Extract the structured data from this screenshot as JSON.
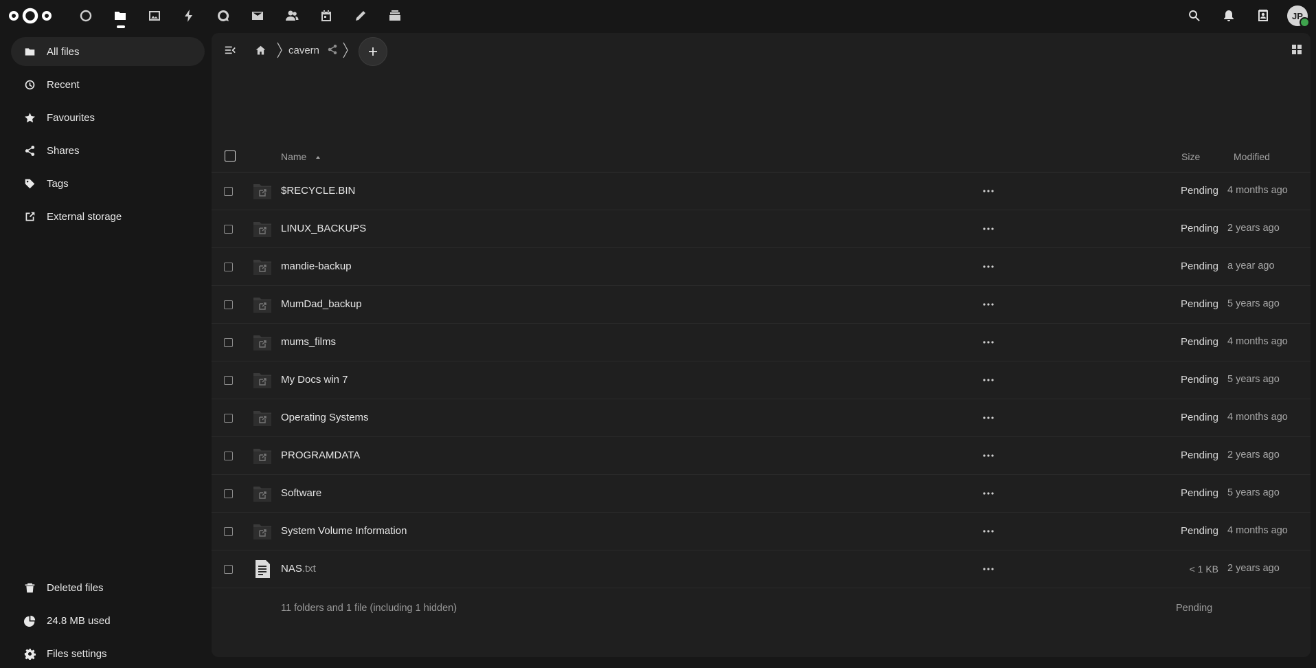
{
  "topbar": {
    "apps": [
      {
        "name": "dashboard-icon"
      },
      {
        "name": "files-icon",
        "active": true
      },
      {
        "name": "photos-icon"
      },
      {
        "name": "activity-icon"
      },
      {
        "name": "talk-icon"
      },
      {
        "name": "mail-icon"
      },
      {
        "name": "contacts-icon"
      },
      {
        "name": "calendar-icon"
      },
      {
        "name": "notes-icon"
      },
      {
        "name": "deck-icon"
      }
    ],
    "avatar_initials": "JP"
  },
  "sidebar": {
    "items": [
      {
        "label": "All files",
        "icon": "folder-icon",
        "active": true
      },
      {
        "label": "Recent",
        "icon": "clock-icon"
      },
      {
        "label": "Favourites",
        "icon": "star-icon"
      },
      {
        "label": "Shares",
        "icon": "share-icon"
      },
      {
        "label": "Tags",
        "icon": "tag-icon"
      },
      {
        "label": "External storage",
        "icon": "external-link-icon"
      }
    ],
    "deleted_files": "Deleted files",
    "quota": "24.8 MB used",
    "settings": "Files settings"
  },
  "breadcrumb": {
    "current": "cavern"
  },
  "table": {
    "headers": {
      "name": "Name",
      "size": "Size",
      "modified": "Modified"
    },
    "rows": [
      {
        "name": "$RECYCLE.BIN",
        "ext": "",
        "type": "folder",
        "size": "Pending",
        "modified": "4 months ago"
      },
      {
        "name": "LINUX_BACKUPS",
        "ext": "",
        "type": "folder",
        "size": "Pending",
        "modified": "2 years ago"
      },
      {
        "name": "mandie-backup",
        "ext": "",
        "type": "folder",
        "size": "Pending",
        "modified": "a year ago"
      },
      {
        "name": "MumDad_backup",
        "ext": "",
        "type": "folder",
        "size": "Pending",
        "modified": "5 years ago"
      },
      {
        "name": "mums_films",
        "ext": "",
        "type": "folder",
        "size": "Pending",
        "modified": "4 months ago"
      },
      {
        "name": "My Docs win 7",
        "ext": "",
        "type": "folder",
        "size": "Pending",
        "modified": "5 years ago"
      },
      {
        "name": "Operating Systems",
        "ext": "",
        "type": "folder",
        "size": "Pending",
        "modified": "4 months ago"
      },
      {
        "name": "PROGRAMDATA",
        "ext": "",
        "type": "folder",
        "size": "Pending",
        "modified": "2 years ago"
      },
      {
        "name": "Software",
        "ext": "",
        "type": "folder",
        "size": "Pending",
        "modified": "5 years ago"
      },
      {
        "name": "System Volume Information",
        "ext": "",
        "type": "folder",
        "size": "Pending",
        "modified": "4 months ago"
      },
      {
        "name": "NAS",
        "ext": ".txt",
        "type": "text",
        "size": "< 1 KB",
        "modified": "2 years ago"
      }
    ],
    "summary": "11 folders and 1 file (including 1 hidden)",
    "summary_size": "Pending"
  }
}
